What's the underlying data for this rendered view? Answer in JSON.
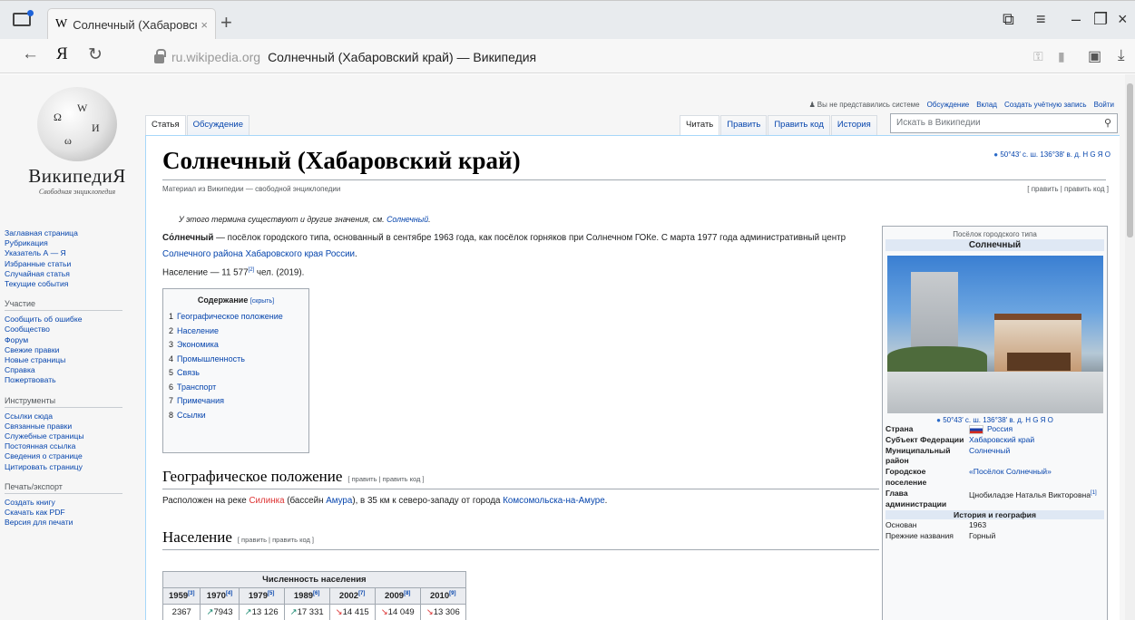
{
  "browser": {
    "tab_favicon": "W",
    "tab_title": "Солнечный (Хабаровск",
    "tab_close": "×",
    "new_tab": "+",
    "yandex_logo": "Я",
    "domain": "ru.wikipedia.org",
    "page_title": "Солнечный (Хабаровский край) — Википедия"
  },
  "wiki": {
    "logo_name": "ВикипедиЯ",
    "logo_slogan": "Свободная энциклопедия",
    "sidebar_main": [
      "Заглавная страница",
      "Рубрикация",
      "Указатель А — Я",
      "Избранные статьи",
      "Случайная статья",
      "Текущие события"
    ],
    "sidebar_participation_title": "Участие",
    "sidebar_participation": [
      "Сообщить об ошибке",
      "Сообщество",
      "Форум",
      "Свежие правки",
      "Новые страницы",
      "Справка",
      "Пожертвовать"
    ],
    "sidebar_tools_title": "Инструменты",
    "sidebar_tools": [
      "Ссылки сюда",
      "Связанные правки",
      "Служебные страницы",
      "Постоянная ссылка",
      "Сведения о странице",
      "Цитировать страницу"
    ],
    "sidebar_print_title": "Печать/экспорт",
    "sidebar_print": [
      "Создать книгу",
      "Скачать как PDF",
      "Версия для печати"
    ],
    "personal_status": "Вы не представились системе",
    "personal_links": [
      "Обсуждение",
      "Вклад",
      "Создать учётную запись",
      "Войти"
    ],
    "tab_article": "Статья",
    "tab_talk": "Обсуждение",
    "tab_read": "Читать",
    "tab_edit": "Править",
    "tab_edit_code": "Править код",
    "tab_history": "История",
    "search_placeholder": "Искать в Википедии",
    "title": "Солнечный (Хабаровский край)",
    "coord_top": "50°43′ с. ш. 136°38′ в. д. H G Я O",
    "site_sub": "Материал из Википедии — свободной энциклопедии",
    "edit_links": "[ править | править код ]",
    "hatnote_text": "У этого термина существуют и другие значения, см. ",
    "hatnote_link": "Солнечный",
    "intro_bold": "Со́лнечный",
    "intro_text": " — посёлок городского типа, основанный в сентябре 1963 года, как посёлок горняков при Солнечном ГОКе. С марта 1977 года административный центр ",
    "intro_link": "Солнечного района Хабаровского края России",
    "population_text": "Население — 11 577",
    "population_ref": "[2]",
    "population_tail": " чел. (2019).",
    "toc_title": "Содержание",
    "toc_hide": "[скрыть]",
    "toc": [
      {
        "n": "1",
        "t": "Географическое положение"
      },
      {
        "n": "2",
        "t": "Население"
      },
      {
        "n": "3",
        "t": "Экономика"
      },
      {
        "n": "4",
        "t": "Промышленность"
      },
      {
        "n": "5",
        "t": "Связь"
      },
      {
        "n": "6",
        "t": "Транспорт"
      },
      {
        "n": "7",
        "t": "Примечания"
      },
      {
        "n": "8",
        "t": "Ссылки"
      }
    ],
    "sec_geo_title": "Географическое положение",
    "sec_edit": "[ править | править код ]",
    "geo_pre": "Расположен на реке ",
    "geo_river": "Силинка",
    "geo_mid": " (бассейн ",
    "geo_basin": "Амура",
    "geo_mid2": "), в 35 км к северо-западу от города ",
    "geo_city": "Комсомольска-на-Амуре",
    "geo_end": ".",
    "sec_pop_title": "Население",
    "pop_table_caption": "Численность населения",
    "pop_years": [
      {
        "y": "1959",
        "r": "[3]"
      },
      {
        "y": "1970",
        "r": "[4]"
      },
      {
        "y": "1979",
        "r": "[5]"
      },
      {
        "y": "1989",
        "r": "[6]"
      },
      {
        "y": "2002",
        "r": "[7]"
      },
      {
        "y": "2009",
        "r": "[8]"
      },
      {
        "y": "2010",
        "r": "[9]"
      }
    ],
    "pop_values": [
      {
        "a": "",
        "v": "2367"
      },
      {
        "a": "↗",
        "v": "7943"
      },
      {
        "a": "↗",
        "v": "13 126"
      },
      {
        "a": "↗",
        "v": "17 331"
      },
      {
        "a": "↘",
        "v": "14 415"
      },
      {
        "a": "↘",
        "v": "14 049"
      },
      {
        "a": "↘",
        "v": "13 306"
      }
    ],
    "infobox": {
      "kind": "Посёлок городского типа",
      "name": "Солнечный",
      "coord": "50°43′ с. ш. 136°38′ в. д. H G Я O",
      "rows": [
        {
          "k": "Страна",
          "v": "Россия",
          "flag": true,
          "link": true
        },
        {
          "k": "Субъект Федерации",
          "v": "Хабаровский край",
          "link": true
        },
        {
          "k": "Муниципальный район",
          "v": "Солнечный",
          "link": true
        },
        {
          "k": "Городское поселение",
          "v": "«Посёлок Солнечный»",
          "link": true
        },
        {
          "k": "Глава администрации",
          "v": "Цнобиладзе Наталья Викторовна",
          "ref": "[1]",
          "link": false
        }
      ],
      "hist_title": "История и география",
      "hist_rows": [
        {
          "k": "Основан",
          "v": "1963"
        },
        {
          "k": "Прежние названия",
          "v": "Горный"
        }
      ]
    }
  }
}
